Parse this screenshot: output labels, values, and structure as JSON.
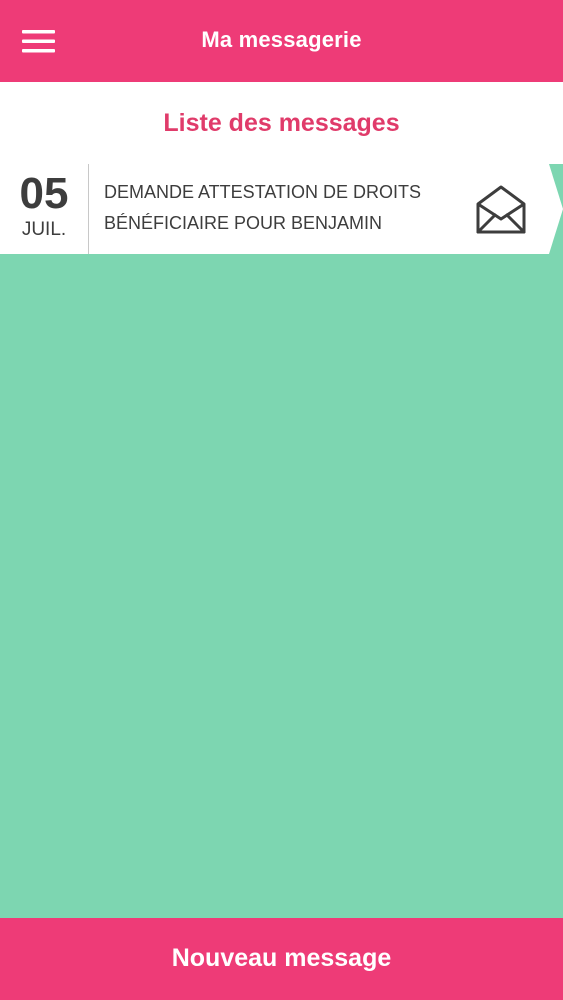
{
  "colors": {
    "primary": "#ee3b77",
    "title_pink": "#e03b6a",
    "background_green": "#7dd6b1",
    "text_dark": "#3d3d3d"
  },
  "header": {
    "menu_icon": "hamburger-menu-icon",
    "title": "Ma messagerie"
  },
  "list": {
    "title": "Liste des messages",
    "messages": [
      {
        "day": "05",
        "month": "JUIL.",
        "subject": "DEMANDE ATTESTATION DE DROITS BÉNÉFICIAIRE POUR BENJAMIN",
        "status_icon": "envelope-open-icon"
      }
    ]
  },
  "footer": {
    "new_message_label": "Nouveau message"
  }
}
